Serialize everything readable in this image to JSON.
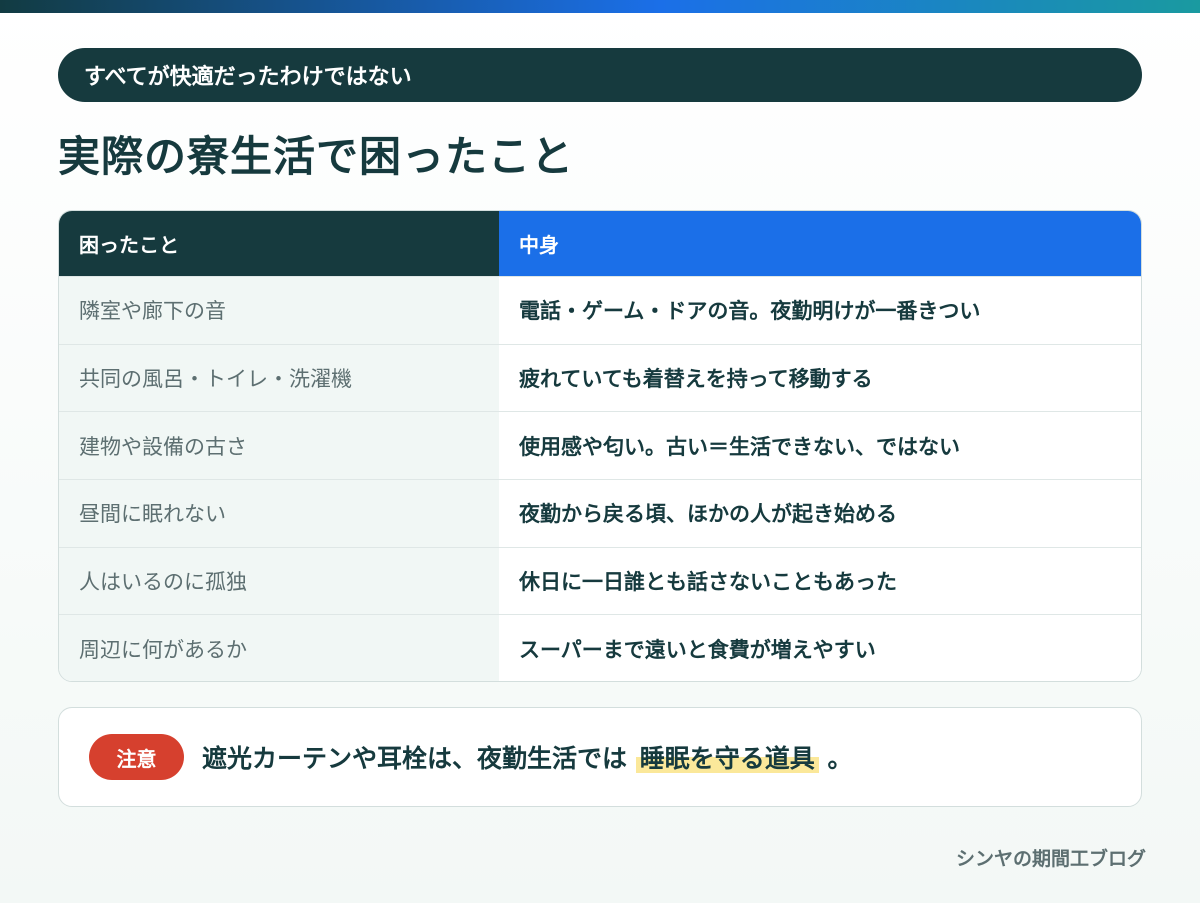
{
  "header": {
    "pill": "すべてが快適だったわけではない",
    "title": "実際の寮生活で困ったこと"
  },
  "table": {
    "columns": [
      "困ったこと",
      "中身"
    ],
    "rows": [
      [
        "隣室や廊下の音",
        "電話・ゲーム・ドアの音。夜勤明けが一番きつい"
      ],
      [
        "共同の風呂・トイレ・洗濯機",
        "疲れていても着替えを持って移動する"
      ],
      [
        "建物や設備の古さ",
        "使用感や匂い。古い＝生活できない、ではない"
      ],
      [
        "昼間に眠れない",
        "夜勤から戻る頃、ほかの人が起き始める"
      ],
      [
        "人はいるのに孤独",
        "休日に一日誰とも話さないこともあった"
      ],
      [
        "周辺に何があるか",
        "スーパーまで遠いと食費が増えやすい"
      ]
    ]
  },
  "note": {
    "badge": "注意",
    "text_before": "遮光カーテンや耳栓は、夜勤生活では",
    "highlight": "睡眠を守る道具",
    "text_after": "。"
  },
  "footer": {
    "brand": "シンヤの期間工ブログ"
  },
  "colors": {
    "dark": "#163a3e",
    "accent": "#1b6fe8",
    "warning": "#d6402e",
    "highlight": "#fbe89a"
  }
}
